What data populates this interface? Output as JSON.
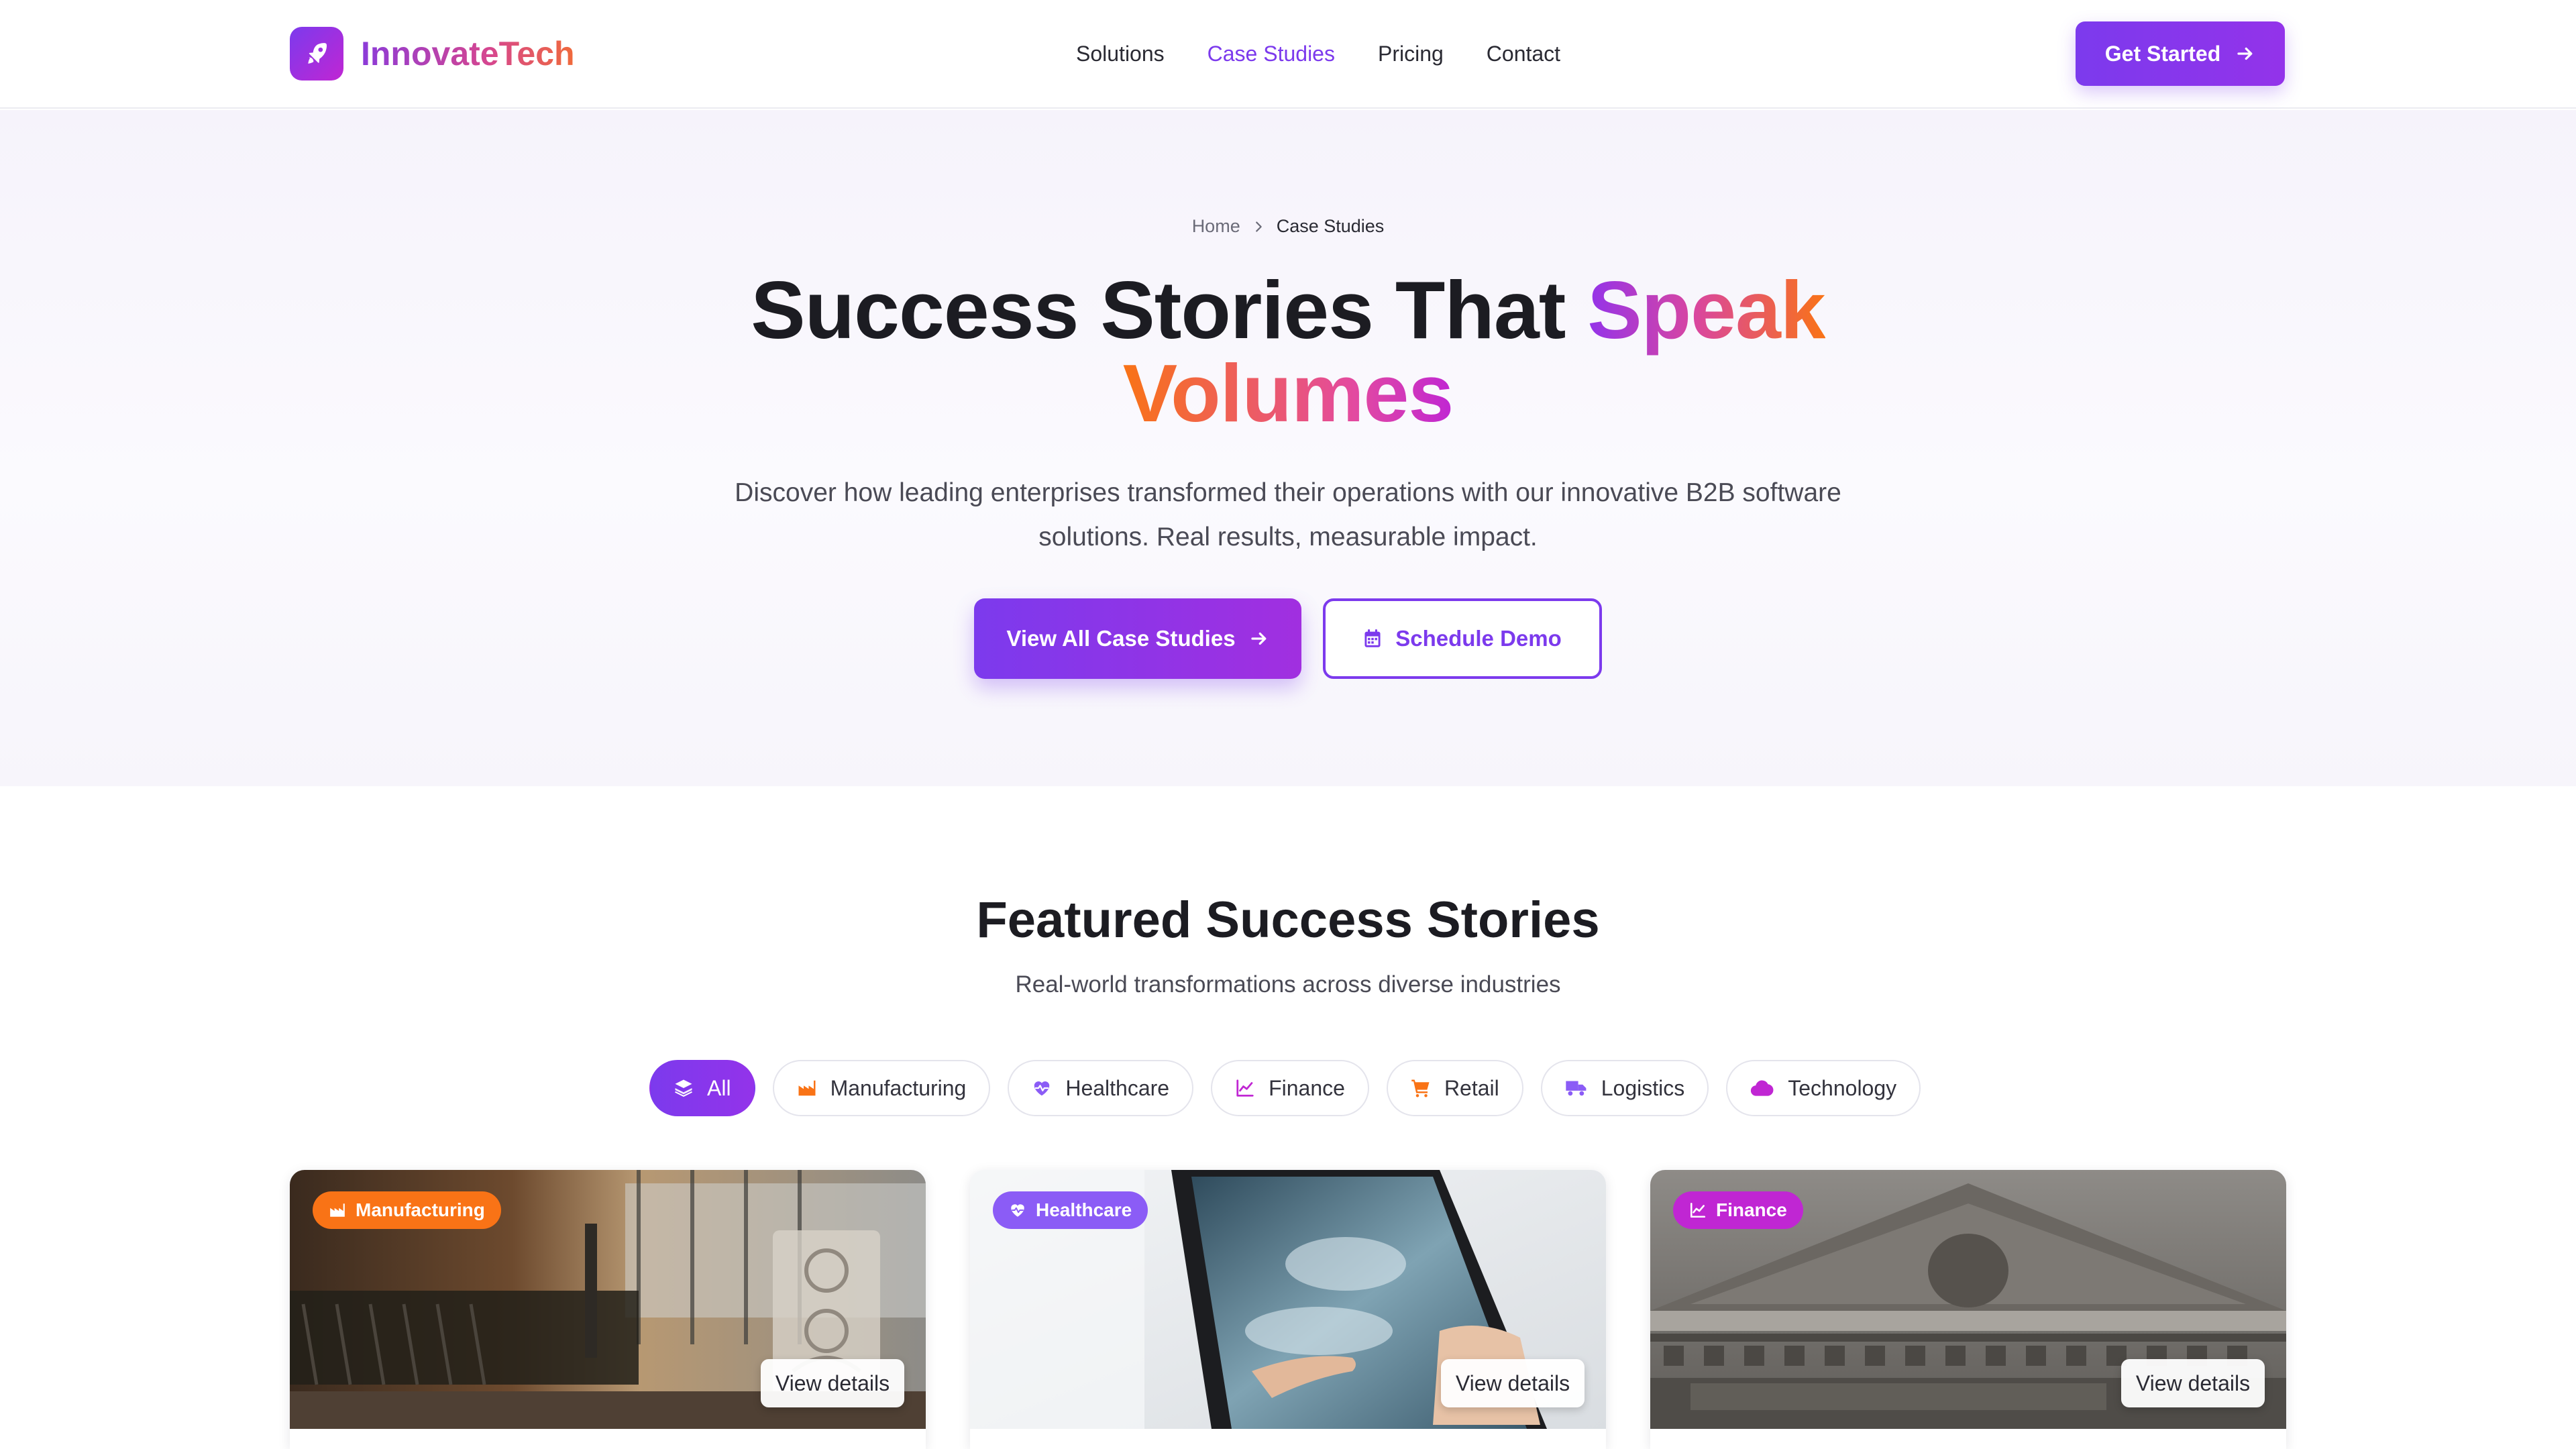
{
  "brand": {
    "name": "InnovateTech",
    "icon": "rocket-icon"
  },
  "nav": {
    "items": [
      {
        "label": "Solutions",
        "active": false
      },
      {
        "label": "Case Studies",
        "active": true
      },
      {
        "label": "Pricing",
        "active": false
      },
      {
        "label": "Contact",
        "active": false
      }
    ],
    "cta_label": "Get Started"
  },
  "hero": {
    "breadcrumb": {
      "home": "Home",
      "current": "Case Studies"
    },
    "title_plain": "Success Stories That ",
    "title_accent_1": "Speak",
    "title_accent_2": "Volumes",
    "subtitle": "Discover how leading enterprises transformed their operations with our innovative B2B software solutions. Real results, measurable impact.",
    "primary_button": "View All Case Studies",
    "secondary_button": "Schedule Demo"
  },
  "featured": {
    "title": "Featured Success Stories",
    "subtitle": "Real-world transformations across diverse industries",
    "filters": [
      {
        "label": "All",
        "icon": "layers-icon",
        "active": true
      },
      {
        "label": "Manufacturing",
        "icon": "factory-icon",
        "active": false
      },
      {
        "label": "Healthcare",
        "icon": "heart-pulse-icon",
        "active": false
      },
      {
        "label": "Finance",
        "icon": "chart-line-icon",
        "active": false
      },
      {
        "label": "Retail",
        "icon": "shopping-cart-icon",
        "active": false
      },
      {
        "label": "Logistics",
        "icon": "truck-icon",
        "active": false
      },
      {
        "label": "Technology",
        "icon": "cloud-icon",
        "active": false
      }
    ],
    "cards": [
      {
        "tag": "Manufacturing",
        "tag_icon": "factory-icon",
        "tag_color": "#f97316",
        "view_label": "View details"
      },
      {
        "tag": "Healthcare",
        "tag_icon": "heart-pulse-icon",
        "tag_color": "#8b5cf6",
        "view_label": "View details"
      },
      {
        "tag": "Finance",
        "tag_icon": "chart-line-icon",
        "tag_color": "#c026d3",
        "view_label": "View details"
      }
    ]
  },
  "colors": {
    "accent": "#7c3aed",
    "accent_2": "#9333ea",
    "orange": "#f97316",
    "pink": "#d946a0"
  }
}
